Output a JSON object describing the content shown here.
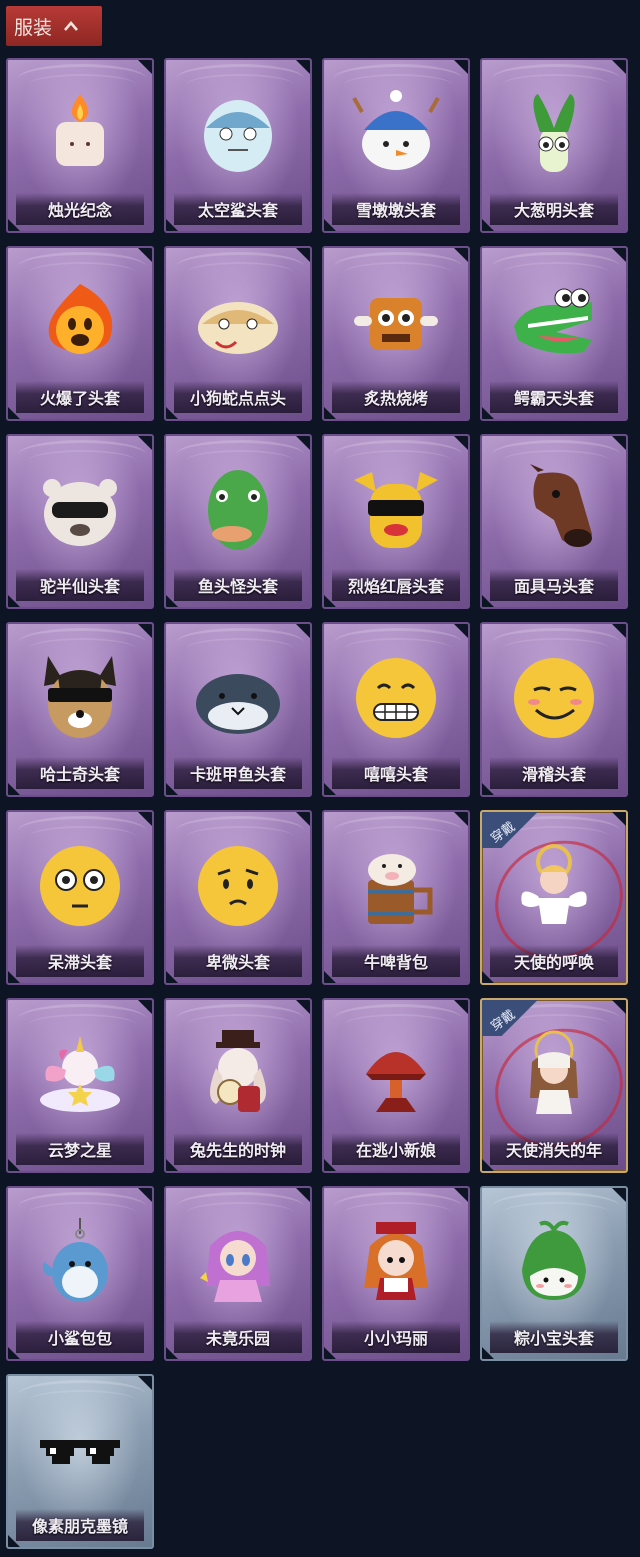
{
  "header": {
    "title": "服装"
  },
  "badge_text": "穿戴",
  "items": [
    {
      "label": "烛光纪念",
      "icon": "candle-icon",
      "theme": "purple",
      "worn": false
    },
    {
      "label": "太空鲨头套",
      "icon": "space-shark-icon",
      "theme": "purple",
      "worn": false
    },
    {
      "label": "雪墩墩头套",
      "icon": "snowman-icon",
      "theme": "purple",
      "worn": false
    },
    {
      "label": "大葱明头套",
      "icon": "scallion-icon",
      "theme": "purple",
      "worn": false
    },
    {
      "label": "火爆了头套",
      "icon": "fireball-icon",
      "theme": "purple",
      "worn": false
    },
    {
      "label": "小狗蛇点点头",
      "icon": "snake-icon",
      "theme": "purple",
      "worn": false
    },
    {
      "label": "炙热烧烤",
      "icon": "roast-meat-icon",
      "theme": "purple",
      "worn": false
    },
    {
      "label": "鳄霸天头套",
      "icon": "crocodile-icon",
      "theme": "purple",
      "worn": false
    },
    {
      "label": "驼半仙头套",
      "icon": "alpaca-icon",
      "theme": "purple",
      "worn": false
    },
    {
      "label": "鱼头怪头套",
      "icon": "fish-head-icon",
      "theme": "purple",
      "worn": false
    },
    {
      "label": "烈焰红唇头套",
      "icon": "yellow-mascot-icon",
      "theme": "purple",
      "worn": false
    },
    {
      "label": "面具马头套",
      "icon": "horse-mask-icon",
      "theme": "purple",
      "worn": false
    },
    {
      "label": "哈士奇头套",
      "icon": "husky-icon",
      "theme": "purple",
      "worn": false
    },
    {
      "label": "卡班甲鱼头套",
      "icon": "fish-icon",
      "theme": "purple",
      "worn": false
    },
    {
      "label": "嘻嘻头套",
      "icon": "grin-emoji-icon",
      "theme": "purple",
      "worn": false
    },
    {
      "label": "滑稽头套",
      "icon": "smirk-emoji-icon",
      "theme": "purple",
      "worn": false
    },
    {
      "label": "呆滞头套",
      "icon": "stunned-emoji-icon",
      "theme": "purple",
      "worn": false
    },
    {
      "label": "卑微头套",
      "icon": "timid-emoji-icon",
      "theme": "purple",
      "worn": false
    },
    {
      "label": "牛啤背包",
      "icon": "beer-mug-icon",
      "theme": "purple",
      "worn": false
    },
    {
      "label": "天使的呼唤",
      "icon": "angel-icon",
      "theme": "purple",
      "worn": true
    },
    {
      "label": "云梦之星",
      "icon": "unicorn-icon",
      "theme": "purple",
      "worn": false
    },
    {
      "label": "兔先生的时钟",
      "icon": "rabbit-clock-icon",
      "theme": "purple",
      "worn": false
    },
    {
      "label": "在逃小新娘",
      "icon": "bride-lamp-icon",
      "theme": "purple",
      "worn": false
    },
    {
      "label": "天使消失的年",
      "icon": "angel-girl-icon",
      "theme": "purple",
      "worn": true
    },
    {
      "label": "小鲨包包",
      "icon": "shark-bag-icon",
      "theme": "purple",
      "worn": false
    },
    {
      "label": "未竟乐园",
      "icon": "doll-icon",
      "theme": "purple",
      "worn": false
    },
    {
      "label": "小小玛丽",
      "icon": "mary-doll-icon",
      "theme": "purple",
      "worn": false
    },
    {
      "label": "粽小宝头套",
      "icon": "zongzi-icon",
      "theme": "blue",
      "worn": false
    },
    {
      "label": "像素朋克墨镜",
      "icon": "pixel-sunglasses-icon",
      "theme": "blue",
      "worn": false
    }
  ],
  "colors": {
    "background": "#0d1524",
    "header": "#a83230",
    "card_purple": "#8e6cab",
    "card_blue": "#8b9db1",
    "worn_badge": "#3b4e79"
  }
}
